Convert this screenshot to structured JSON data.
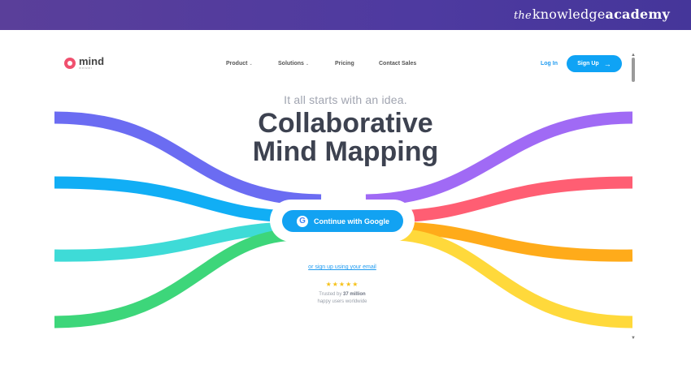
{
  "banner": {
    "brand_prefix": "the",
    "brand_main": "knowledge",
    "brand_bold": "academy"
  },
  "site": {
    "logo_name": "mind",
    "logo_sub": "meister"
  },
  "nav": {
    "items": [
      {
        "label": "Product",
        "has_menu": true
      },
      {
        "label": "Solutions",
        "has_menu": true
      },
      {
        "label": "Pricing",
        "has_menu": false
      },
      {
        "label": "Contact Sales",
        "has_menu": false
      }
    ],
    "login": "Log In",
    "signup": "Sign Up"
  },
  "hero": {
    "tagline": "It all starts with an idea.",
    "title_line1": "Collaborative",
    "title_line2": "Mind Mapping",
    "google_button": "Continue with Google",
    "email_link": "or sign up using your email",
    "stars": "★★★★★",
    "trusted_prefix": "Trusted by",
    "trusted_count": "37 million",
    "trusted_suffix": "happy users worldwide"
  },
  "colors": {
    "banner": "#4e3aa0",
    "accent": "#12a2f2",
    "ribbon_left": [
      "#6b6cf2",
      "#11aef5",
      "#3edbd7",
      "#3dd67a"
    ],
    "ribbon_right": [
      "#a06af5",
      "#ff5e73",
      "#ffab1a",
      "#ffd93b"
    ]
  }
}
